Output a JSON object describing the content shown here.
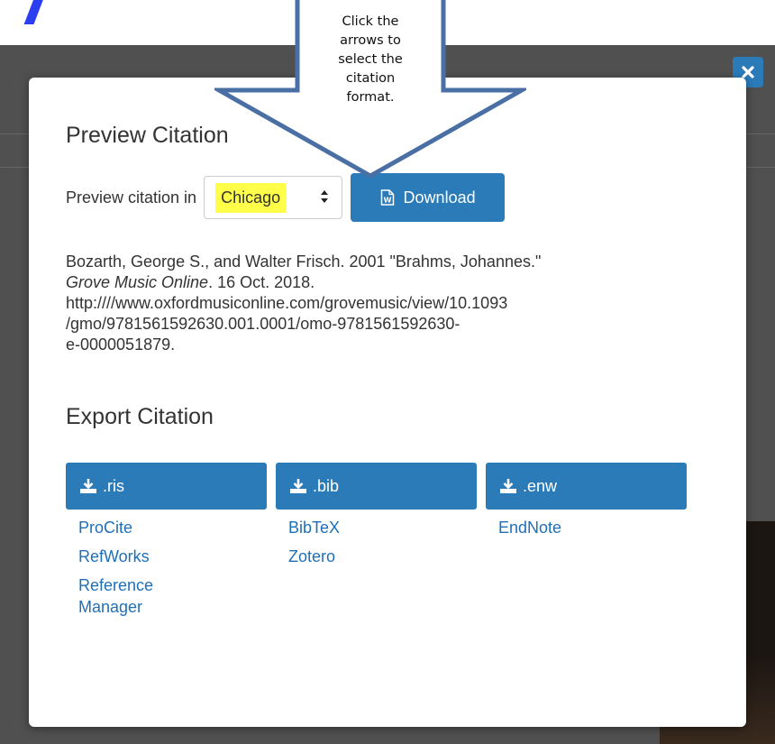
{
  "callout": {
    "lines": [
      "Click the",
      "arrows to",
      "select the",
      "citation",
      "format."
    ]
  },
  "modal": {
    "close_icon": "times-icon",
    "preview": {
      "title": "Preview Citation",
      "label": "Preview citation in",
      "selected_format": "Chicago",
      "download_label": "Download",
      "download_icon": "word-document-icon"
    },
    "citation": {
      "line1": "Bozarth, George S., and Walter Frisch. 2001 \"Brahms, Johannes.\"",
      "line2_italic": "Grove Music Online",
      "line2_rest": ". 16 Oct. 2018.",
      "line3": "http:////www.oxfordmusiconline.com/grovemusic/view/10.1093",
      "line4": "/gmo/9781561592630.001.0001/omo-9781561592630-",
      "line5": "e-0000051879."
    },
    "export": {
      "title": "Export Citation",
      "columns": [
        {
          "button": ".ris",
          "links": [
            "ProCite",
            "RefWorks",
            "Reference Manager"
          ]
        },
        {
          "button": ".bib",
          "links": [
            "BibTeX",
            "Zotero"
          ]
        },
        {
          "button": ".enw",
          "links": [
            "EndNote"
          ]
        }
      ]
    }
  },
  "colors": {
    "accent": "#2b7bb9",
    "link": "#1f6fb8",
    "highlight": "#ffff4a",
    "backdrop": "#505050"
  }
}
